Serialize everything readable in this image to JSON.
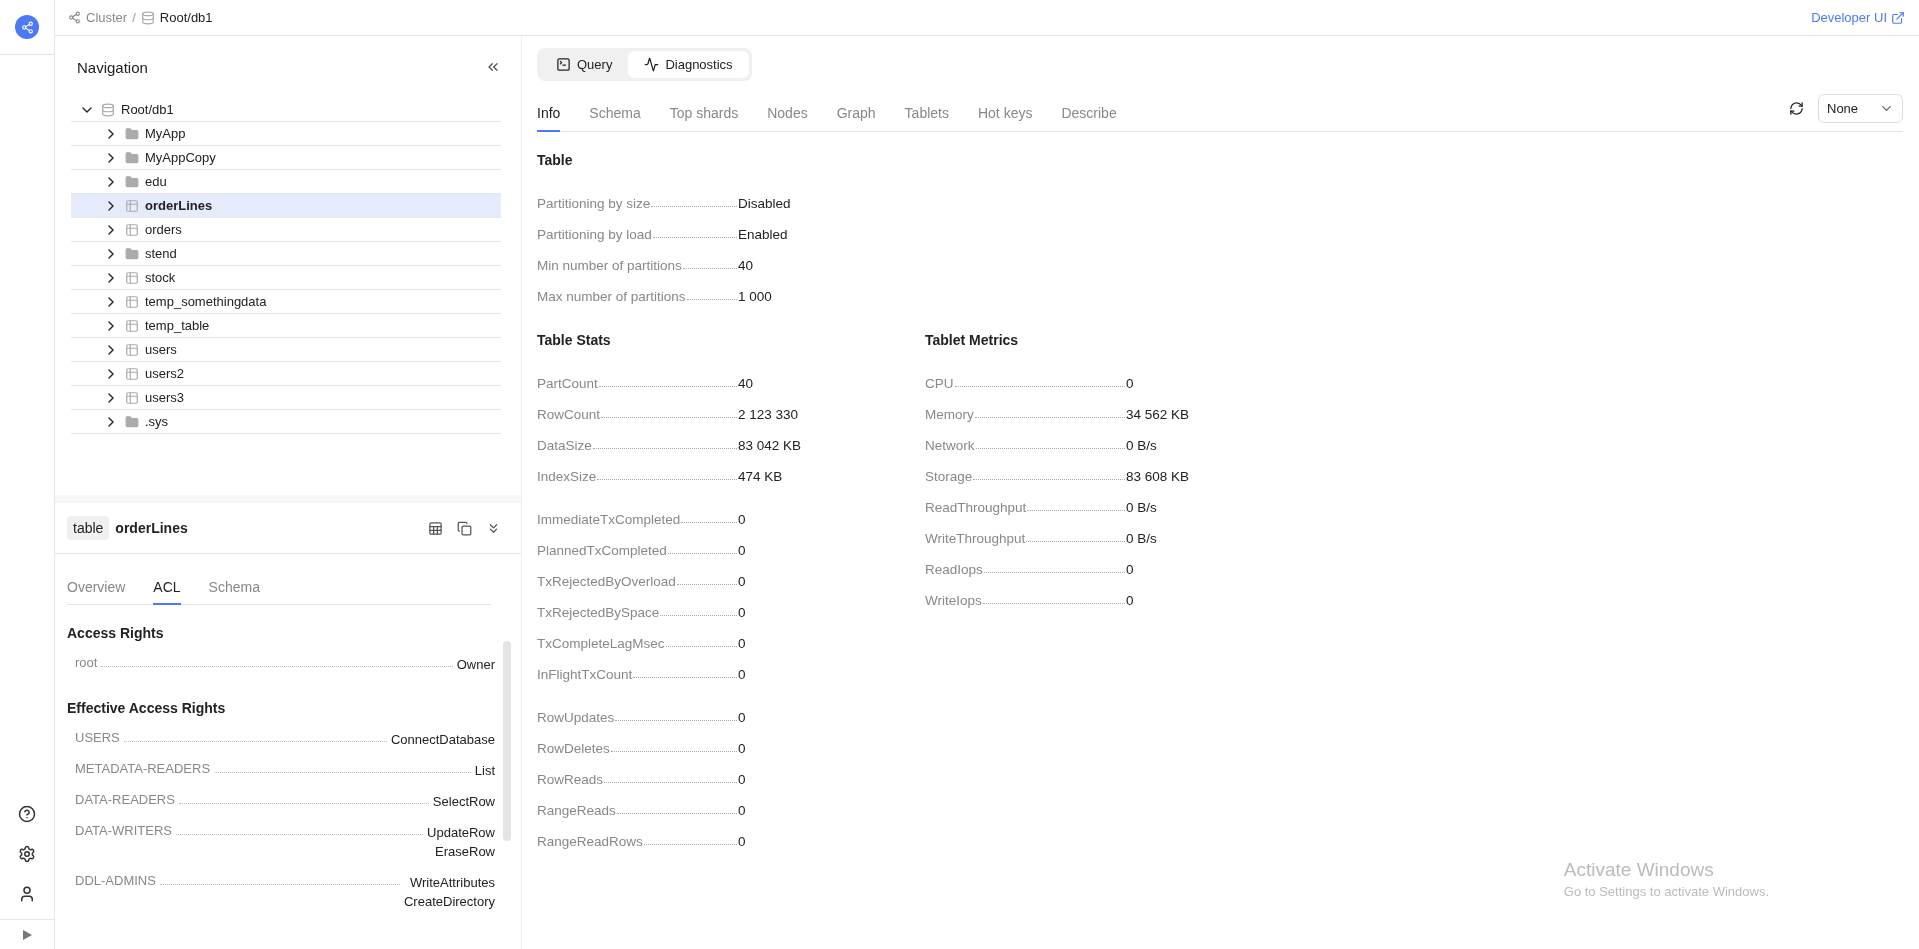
{
  "breadcrumb": {
    "items": [
      {
        "label": "Cluster",
        "kind": "cluster"
      },
      {
        "label": "Root/db1",
        "kind": "database"
      }
    ],
    "separator": "/"
  },
  "developer_link": "Developer UI",
  "navigation": {
    "title": "Navigation",
    "tree": [
      {
        "label": "Root/db1",
        "kind": "database",
        "expanded": true,
        "selected": false,
        "children": [
          {
            "label": "MyApp",
            "kind": "folder",
            "expanded": false,
            "selected": false
          },
          {
            "label": "MyAppCopy",
            "kind": "folder",
            "expanded": false,
            "selected": false
          },
          {
            "label": "edu",
            "kind": "folder",
            "expanded": false,
            "selected": false
          },
          {
            "label": "orderLines",
            "kind": "table",
            "expanded": false,
            "selected": true
          },
          {
            "label": "orders",
            "kind": "table",
            "expanded": false,
            "selected": false
          },
          {
            "label": "stend",
            "kind": "folder",
            "expanded": false,
            "selected": false
          },
          {
            "label": "stock",
            "kind": "table",
            "expanded": false,
            "selected": false
          },
          {
            "label": "temp_somethingdata",
            "kind": "table",
            "expanded": false,
            "selected": false
          },
          {
            "label": "temp_table",
            "kind": "table",
            "expanded": false,
            "selected": false
          },
          {
            "label": "users",
            "kind": "table",
            "expanded": false,
            "selected": false
          },
          {
            "label": "users2",
            "kind": "table",
            "expanded": false,
            "selected": false
          },
          {
            "label": "users3",
            "kind": "table",
            "expanded": false,
            "selected": false
          },
          {
            "label": ".sys",
            "kind": "folder",
            "expanded": false,
            "selected": false
          }
        ]
      }
    ]
  },
  "details": {
    "type_badge": "table",
    "name": "orderLines",
    "tabs": [
      {
        "label": "Overview",
        "selected": false
      },
      {
        "label": "ACL",
        "selected": true
      },
      {
        "label": "Schema",
        "selected": false
      }
    ],
    "sections": [
      {
        "title": "Access Rights",
        "rows": [
          {
            "subject": "root",
            "rights": [
              "Owner"
            ]
          }
        ]
      },
      {
        "title": "Effective Access Rights",
        "rows": [
          {
            "subject": "USERS",
            "rights": [
              "ConnectDatabase"
            ]
          },
          {
            "subject": "METADATA-READERS",
            "rights": [
              "List"
            ]
          },
          {
            "subject": "DATA-READERS",
            "rights": [
              "SelectRow"
            ]
          },
          {
            "subject": "DATA-WRITERS",
            "rights": [
              "UpdateRow",
              "EraseRow"
            ]
          },
          {
            "subject": "DDL-ADMINS",
            "rights": [
              "WriteAttributes",
              "CreateDirectory"
            ]
          }
        ]
      }
    ]
  },
  "view_switch": [
    {
      "label": "Query",
      "kind": "query",
      "selected": false
    },
    {
      "label": "Diagnostics",
      "kind": "diagnostics",
      "selected": true
    }
  ],
  "tabs": [
    {
      "label": "Info",
      "selected": true
    },
    {
      "label": "Schema",
      "selected": false
    },
    {
      "label": "Top shards",
      "selected": false
    },
    {
      "label": "Nodes",
      "selected": false
    },
    {
      "label": "Graph",
      "selected": false
    },
    {
      "label": "Tablets",
      "selected": false
    },
    {
      "label": "Hot keys",
      "selected": false
    },
    {
      "label": "Describe",
      "selected": false
    }
  ],
  "refresh_select": {
    "value": "None"
  },
  "info": {
    "table": {
      "title": "Table",
      "rows": [
        {
          "label": "Partitioning by size",
          "value": "Disabled"
        },
        {
          "label": "Partitioning by load",
          "value": "Enabled"
        },
        {
          "label": "Min number of partitions",
          "value": "40"
        },
        {
          "label": "Max number of partitions",
          "value": "1 000"
        }
      ]
    },
    "columns": [
      {
        "title": "Table Stats",
        "groups": [
          [
            {
              "label": "PartCount",
              "value": "40"
            },
            {
              "label": "RowCount",
              "value": "2 123 330"
            },
            {
              "label": "DataSize",
              "value": "83 042 KB"
            },
            {
              "label": "IndexSize",
              "value": "474 KB"
            }
          ],
          [
            {
              "label": "ImmediateTxCompleted",
              "value": "0"
            },
            {
              "label": "PlannedTxCompleted",
              "value": "0"
            },
            {
              "label": "TxRejectedByOverload",
              "value": "0"
            },
            {
              "label": "TxRejectedBySpace",
              "value": "0"
            },
            {
              "label": "TxCompleteLagMsec",
              "value": "0"
            },
            {
              "label": "InFlightTxCount",
              "value": "0"
            }
          ],
          [
            {
              "label": "RowUpdates",
              "value": "0"
            },
            {
              "label": "RowDeletes",
              "value": "0"
            },
            {
              "label": "RowReads",
              "value": "0"
            },
            {
              "label": "RangeReads",
              "value": "0"
            },
            {
              "label": "RangeReadRows",
              "value": "0"
            }
          ]
        ]
      },
      {
        "title": "Tablet Metrics",
        "groups": [
          [
            {
              "label": "CPU",
              "value": "0"
            },
            {
              "label": "Memory",
              "value": "34 562 KB"
            },
            {
              "label": "Network",
              "value": "0 B/s"
            },
            {
              "label": "Storage",
              "value": "83 608 KB"
            },
            {
              "label": "ReadThroughput",
              "value": "0 B/s"
            },
            {
              "label": "WriteThroughput",
              "value": "0 B/s"
            },
            {
              "label": "ReadIops",
              "value": "0"
            },
            {
              "label": "WriteIops",
              "value": "0"
            }
          ]
        ]
      }
    ]
  },
  "os_notice": {
    "title": "Activate Windows",
    "text": "Go to Settings to activate Windows."
  }
}
